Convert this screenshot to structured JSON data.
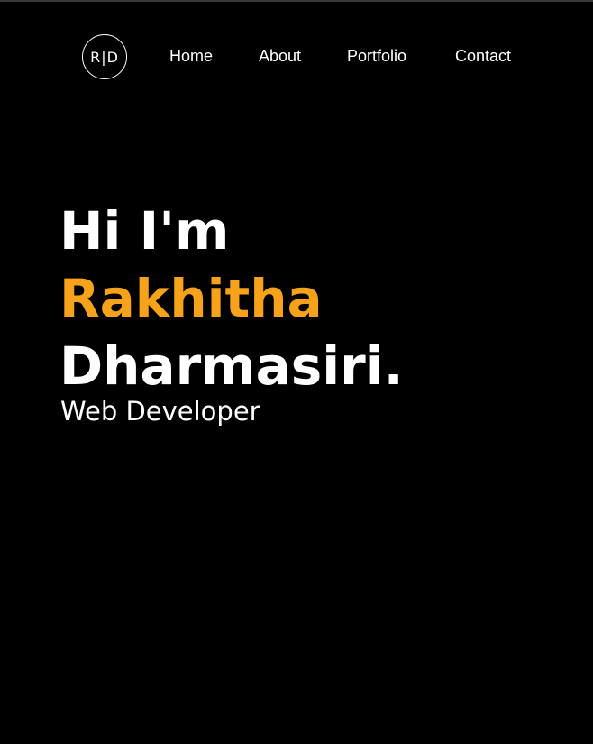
{
  "logo": {
    "left": "R",
    "separator": "|",
    "right": "D"
  },
  "nav": {
    "items": [
      "Home",
      "About",
      "Portfolio",
      "Contact"
    ]
  },
  "hero": {
    "greeting": "Hi I'm",
    "first_name": "Rakhitha",
    "last_name": "Dharmasiri.",
    "role": "Web Developer"
  },
  "colors": {
    "background": "#000000",
    "text": "#ffffff",
    "accent": "#f6a21b"
  }
}
